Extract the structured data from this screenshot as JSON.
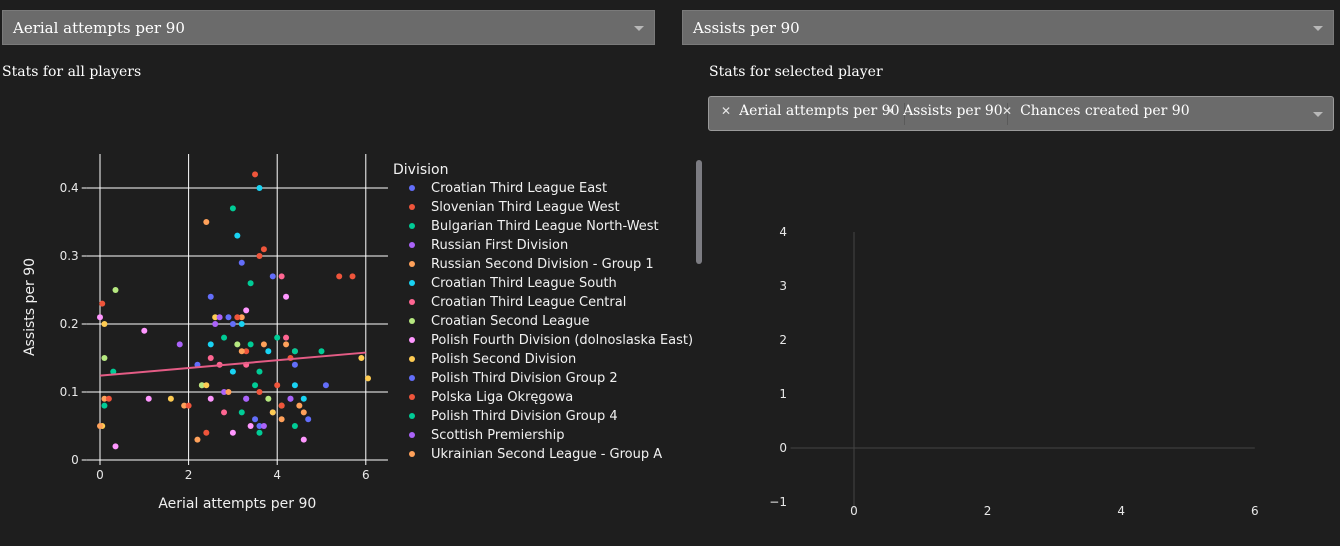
{
  "controls": {
    "x_dropdown": {
      "value": "Aerial attempts per 90"
    },
    "y_dropdown": {
      "value": "Assists per 90"
    },
    "multi_select": {
      "chips": [
        "Aerial attempts per 90",
        "Assists per 90",
        "Chances created per 90"
      ]
    }
  },
  "titles": {
    "all_players": "Stats for all players",
    "selected_player": "Stats for selected player"
  },
  "colors": {
    "background": "#1e1e1e",
    "control": "#6b6b6b",
    "trendline": "#e45c85",
    "grid": "#ffffff"
  },
  "chart_data": [
    {
      "type": "scatter",
      "title": "",
      "xlabel": "Aerial attempts per 90",
      "ylabel": "Assists per 90",
      "xlim": [
        -0.3,
        6.5
      ],
      "ylim": [
        0,
        0.45
      ],
      "xticks": [
        0,
        2,
        4,
        6
      ],
      "yticks": [
        0,
        0.1,
        0.2,
        0.3,
        0.4
      ],
      "grid": true,
      "legend_title": "Division",
      "legend_placement": "right",
      "trendline": {
        "x": [
          0,
          6
        ],
        "y": [
          0.124,
          0.158
        ],
        "color": "#e45c85"
      },
      "series": [
        {
          "name": "Croatian Third League East",
          "color": "#636efa",
          "points": [
            [
              2.5,
              0.24
            ],
            [
              3.2,
              0.29
            ],
            [
              3.9,
              0.27
            ],
            [
              4.7,
              0.06
            ],
            [
              5.1,
              0.11
            ],
            [
              2.9,
              0.21
            ],
            [
              3.6,
              0.05
            ],
            [
              4.3,
              0.09
            ]
          ]
        },
        {
          "name": "Slovenian Third League West",
          "color": "#ef553b",
          "points": [
            [
              3.5,
              0.42
            ],
            [
              3.7,
              0.31
            ],
            [
              3.6,
              0.3
            ],
            [
              5.4,
              0.27
            ],
            [
              5.7,
              0.27
            ],
            [
              0.05,
              0.23
            ],
            [
              4.0,
              0.11
            ],
            [
              3.3,
              0.16
            ],
            [
              2.4,
              0.04
            ]
          ]
        },
        {
          "name": "Bulgarian Third League North-West",
          "color": "#00cc96",
          "points": [
            [
              3.0,
              0.37
            ],
            [
              3.4,
              0.26
            ],
            [
              5.0,
              0.16
            ],
            [
              0.1,
              0.08
            ],
            [
              0.3,
              0.13
            ],
            [
              3.6,
              0.13
            ],
            [
              4.0,
              0.18
            ],
            [
              4.4,
              0.05
            ],
            [
              3.4,
              0.17
            ]
          ]
        },
        {
          "name": "Russian First Division",
          "color": "#ab63fa",
          "points": [
            [
              1.8,
              0.17
            ],
            [
              4.3,
              0.09
            ],
            [
              3.3,
              0.09
            ],
            [
              2.6,
              0.2
            ],
            [
              3.9,
              0.07
            ]
          ]
        },
        {
          "name": "Russian Second Division - Group 1",
          "color": "#ffa15a",
          "points": [
            [
              2.4,
              0.35
            ],
            [
              1.9,
              0.08
            ],
            [
              2.3,
              0.11
            ],
            [
              4.2,
              0.17
            ],
            [
              4.6,
              0.07
            ],
            [
              3.2,
              0.21
            ],
            [
              0.1,
              0.09
            ]
          ]
        },
        {
          "name": "Croatian Third League South",
          "color": "#19d3f3",
          "points": [
            [
              3.6,
              0.4
            ],
            [
              3.1,
              0.33
            ],
            [
              3.2,
              0.2
            ],
            [
              3.8,
              0.16
            ],
            [
              2.5,
              0.17
            ],
            [
              4.4,
              0.11
            ],
            [
              4.6,
              0.09
            ],
            [
              3.0,
              0.13
            ]
          ]
        },
        {
          "name": "Croatian Third League Central",
          "color": "#ff6692",
          "points": [
            [
              4.1,
              0.27
            ],
            [
              4.2,
              0.18
            ],
            [
              4.4,
              0.16
            ],
            [
              2.5,
              0.15
            ],
            [
              3.3,
              0.14
            ],
            [
              2.8,
              0.07
            ],
            [
              2.7,
              0.14
            ]
          ]
        },
        {
          "name": "Croatian Second League",
          "color": "#b6e880",
          "points": [
            [
              0.35,
              0.25
            ],
            [
              0.1,
              0.15
            ],
            [
              3.1,
              0.17
            ],
            [
              2.3,
              0.11
            ],
            [
              3.8,
              0.09
            ]
          ]
        },
        {
          "name": "Polish Fourth Division (dolnoslaska East)",
          "color": "#ff97ff",
          "points": [
            [
              0.0,
              0.21
            ],
            [
              1.0,
              0.19
            ],
            [
              0.35,
              0.02
            ],
            [
              4.2,
              0.24
            ],
            [
              3.3,
              0.22
            ],
            [
              4.6,
              0.03
            ],
            [
              2.5,
              0.09
            ],
            [
              1.1,
              0.09
            ],
            [
              3.0,
              0.04
            ],
            [
              3.4,
              0.05
            ]
          ]
        },
        {
          "name": "Polish Second Division",
          "color": "#fecb52",
          "points": [
            [
              0.1,
              0.2
            ],
            [
              2.6,
              0.21
            ],
            [
              3.9,
              0.07
            ],
            [
              5.9,
              0.15
            ],
            [
              6.05,
              0.12
            ],
            [
              1.6,
              0.09
            ],
            [
              0.05,
              0.05
            ],
            [
              2.4,
              0.11
            ],
            [
              4.1,
              0.08
            ]
          ]
        },
        {
          "name": "Polish Third Division Group 2",
          "color": "#636efa",
          "points": [
            [
              3.0,
              0.2
            ],
            [
              3.5,
              0.06
            ],
            [
              4.4,
              0.14
            ],
            [
              2.2,
              0.14
            ]
          ]
        },
        {
          "name": "Polska Liga Okręgowa",
          "color": "#ef553b",
          "points": [
            [
              3.6,
              0.1
            ],
            [
              4.3,
              0.15
            ],
            [
              2.0,
              0.08
            ],
            [
              3.1,
              0.21
            ],
            [
              0.2,
              0.09
            ],
            [
              4.1,
              0.08
            ]
          ]
        },
        {
          "name": "Polish Third Division Group 4",
          "color": "#00cc96",
          "points": [
            [
              4.4,
              0.16
            ],
            [
              3.2,
              0.07
            ],
            [
              3.5,
              0.11
            ],
            [
              3.6,
              0.04
            ],
            [
              2.8,
              0.18
            ]
          ]
        },
        {
          "name": "Scottish Premiership",
          "color": "#ab63fa",
          "points": [
            [
              3.3,
              0.09
            ],
            [
              2.7,
              0.21
            ],
            [
              3.7,
              0.05
            ],
            [
              2.8,
              0.1
            ]
          ]
        },
        {
          "name": "Ukrainian Second League - Group A",
          "color": "#ffa15a",
          "points": [
            [
              4.5,
              0.08
            ],
            [
              4.1,
              0.06
            ],
            [
              3.2,
              0.16
            ],
            [
              2.9,
              0.1
            ],
            [
              3.7,
              0.17
            ],
            [
              2.2,
              0.03
            ],
            [
              0.0,
              0.05
            ]
          ]
        }
      ]
    },
    {
      "type": "line",
      "title": "",
      "xlabel": "",
      "ylabel": "",
      "xlim": [
        -1.5,
        6.3
      ],
      "ylim": [
        -1,
        4.3
      ],
      "xticks": [
        0,
        2,
        4,
        6
      ],
      "yticks": [
        -1,
        0,
        1,
        2,
        3,
        4
      ],
      "grid": false,
      "series": []
    }
  ]
}
